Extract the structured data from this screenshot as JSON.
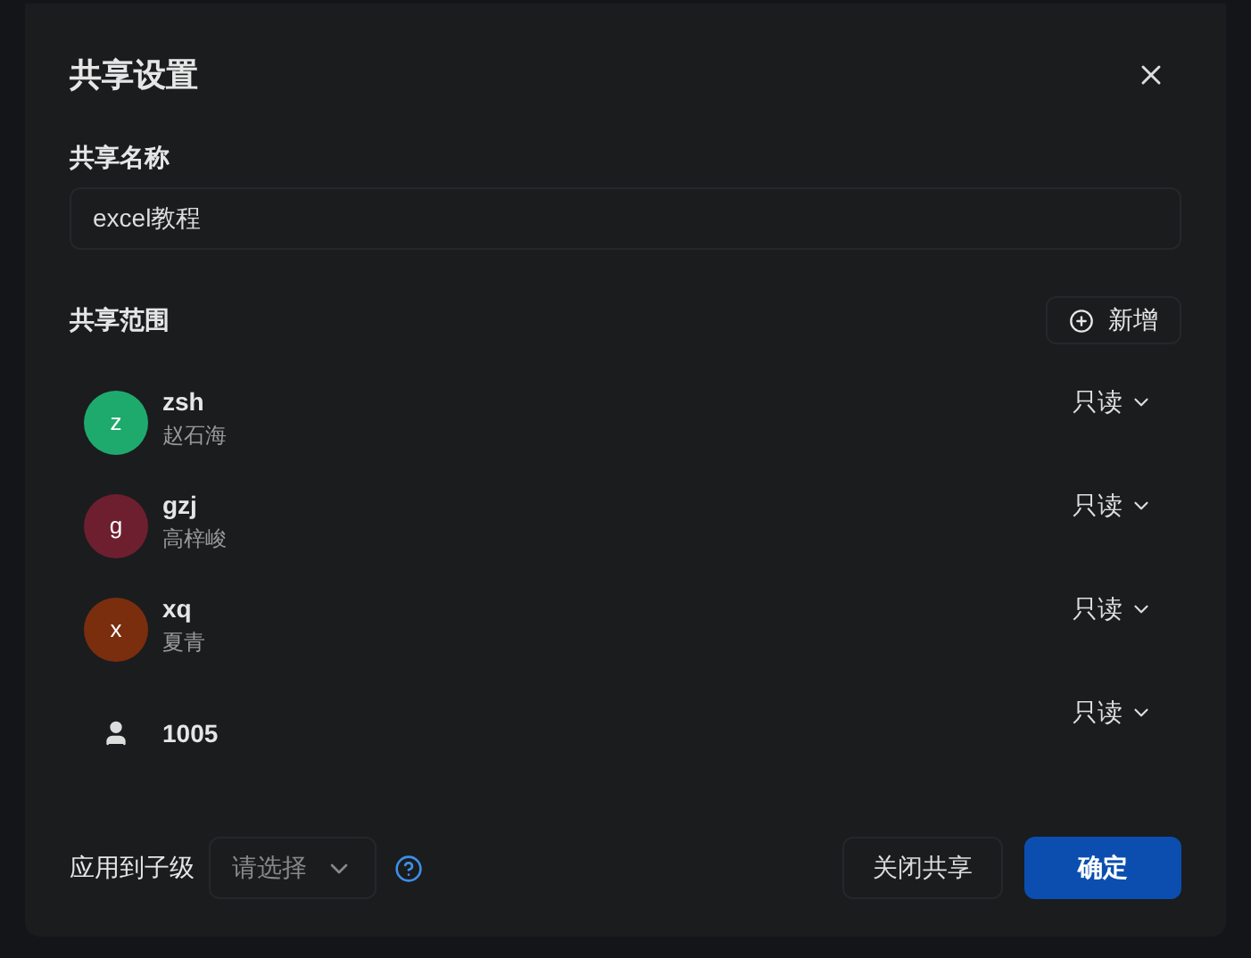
{
  "dialog": {
    "title": "共享设置"
  },
  "name_field": {
    "label": "共享名称",
    "value": "excel教程"
  },
  "scope": {
    "label": "共享范围",
    "add_button": "新增",
    "members": [
      {
        "kind": "letter",
        "avatar": "z",
        "color": "#1faa6d",
        "name": "zsh",
        "subtitle": "赵石海",
        "permission": "只读"
      },
      {
        "kind": "letter",
        "avatar": "g",
        "color": "#6e1f2f",
        "name": "gzj",
        "subtitle": "高梓峻",
        "permission": "只读"
      },
      {
        "kind": "letter",
        "avatar": "x",
        "color": "#7a2e0e",
        "name": "xq",
        "subtitle": "夏青",
        "permission": "只读"
      },
      {
        "kind": "person",
        "name": "1005",
        "permission": "只读"
      }
    ]
  },
  "footer": {
    "apply_label": "应用到子级",
    "apply_select": {
      "placeholder": "请选择"
    },
    "buttons": [
      {
        "label": "关闭共享",
        "kind": "secondary"
      },
      {
        "label": "确定",
        "kind": "primary"
      }
    ]
  }
}
